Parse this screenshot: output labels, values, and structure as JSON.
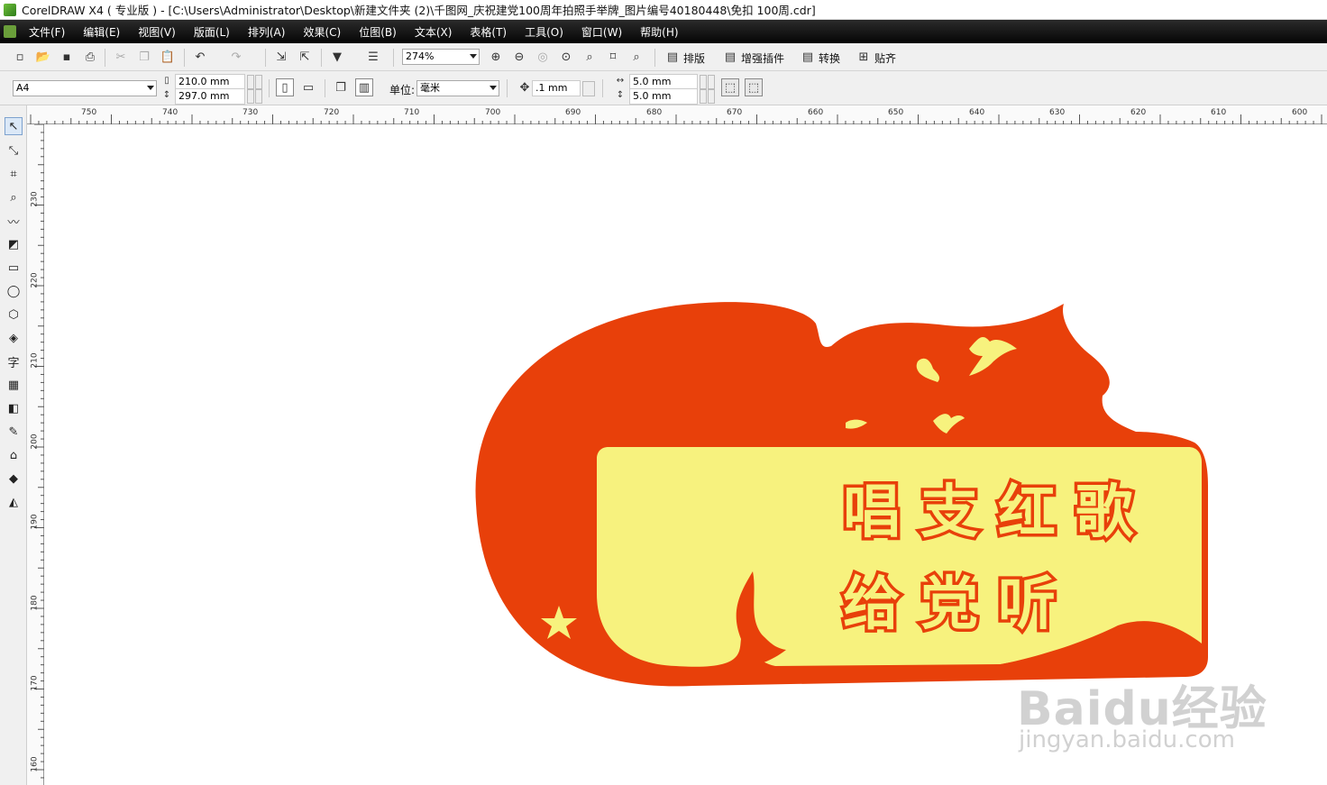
{
  "window": {
    "title": "CorelDRAW X4 ( 专业版 ) - [C:\\Users\\Administrator\\Desktop\\新建文件夹 (2)\\千图网_庆祝建党100周年拍照手举牌_图片编号40180448\\免扣 100周.cdr]"
  },
  "menu": [
    "文件(F)",
    "编辑(E)",
    "视图(V)",
    "版面(L)",
    "排列(A)",
    "效果(C)",
    "位图(B)",
    "文本(X)",
    "表格(T)",
    "工具(O)",
    "窗口(W)",
    "帮助(H)"
  ],
  "toolbar": {
    "zoom": "274%",
    "plugins": [
      "排版",
      "增强插件",
      "转换",
      "贴齐"
    ]
  },
  "property_bar": {
    "page_size": "A4",
    "width": "210.0 mm",
    "height": "297.0 mm",
    "unit_label": "单位:",
    "unit_value": "毫米",
    "nudge": ".1 mm",
    "dup_x": "5.0 mm",
    "dup_y": "5.0 mm"
  },
  "ruler": {
    "top": [
      "750",
      "740",
      "730",
      "720",
      "710",
      "700",
      "690",
      "680",
      "670",
      "660",
      "650",
      "640",
      "630",
      "620",
      "610",
      "600"
    ],
    "left": [
      "230",
      "220",
      "210",
      "200",
      "190",
      "180",
      "170",
      "160"
    ]
  },
  "artwork": {
    "line1": "唱支红歌",
    "line2": "给党听",
    "colors": {
      "red": "#e8400a",
      "yellow": "#f7f27e",
      "text": "#e8400a"
    }
  },
  "watermark": {
    "brand": "Baidu经验",
    "url": "jingyan.baidu.com"
  }
}
